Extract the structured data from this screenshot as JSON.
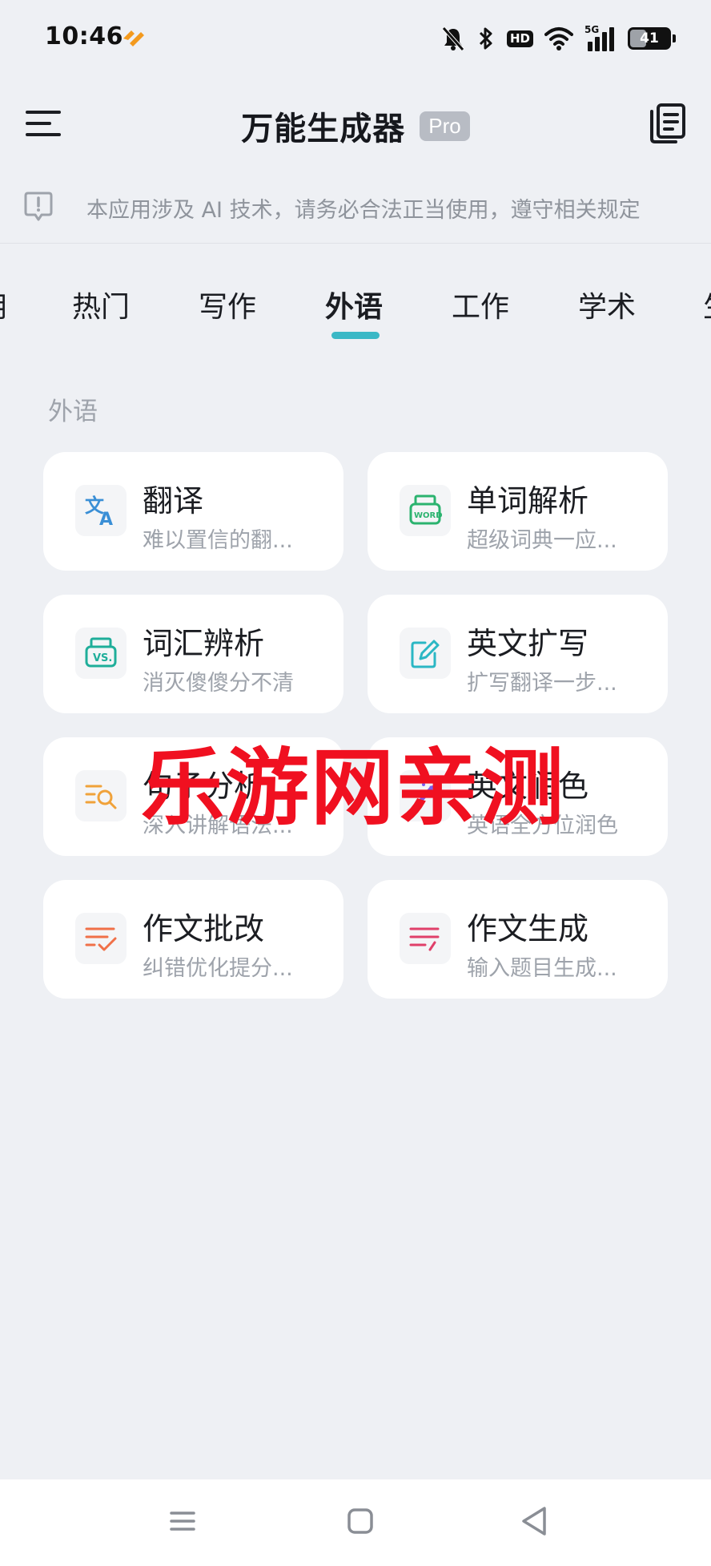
{
  "status_bar": {
    "time": "10:46",
    "hd_label": "HD",
    "network_label": "5G",
    "battery_level": "41"
  },
  "header": {
    "title": "万能生成器",
    "pro_label": "Pro"
  },
  "notice": {
    "text": "本应用涉及 AI 技术，请务必合法正当使用，遵守相关规定"
  },
  "tabs": [
    {
      "label": "用"
    },
    {
      "label": "热门"
    },
    {
      "label": "写作"
    },
    {
      "label": "外语",
      "active": true
    },
    {
      "label": "工作"
    },
    {
      "label": "学术"
    },
    {
      "label": "生"
    }
  ],
  "section": {
    "title": "外语",
    "cards": [
      {
        "title": "翻译",
        "desc": "难以置信的翻...",
        "icon": "translate-icon",
        "color": "#3a8fd6"
      },
      {
        "title": "单词解析",
        "desc": "超级词典一应...",
        "icon": "word-icon",
        "color": "#2bb36f"
      },
      {
        "title": "词汇辨析",
        "desc": "消灭傻傻分不清",
        "icon": "vs-icon",
        "color": "#1fae9a"
      },
      {
        "title": "英文扩写",
        "desc": "扩写翻译一步...",
        "icon": "edit-icon",
        "color": "#2bb7c4"
      },
      {
        "title": "句子分析",
        "desc": "深入讲解语法...",
        "icon": "analyze-icon",
        "color": "#f0a23a"
      },
      {
        "title": "英文润色",
        "desc": "英语全方位润色",
        "icon": "magic-icon",
        "color": "#7a5cf0"
      },
      {
        "title": "作文批改",
        "desc": "纠错优化提分...",
        "icon": "check-icon",
        "color": "#f07048"
      },
      {
        "title": "作文生成",
        "desc": "输入题目生成...",
        "icon": "write-icon",
        "color": "#e0406a"
      }
    ]
  },
  "watermark": "乐游网亲测"
}
